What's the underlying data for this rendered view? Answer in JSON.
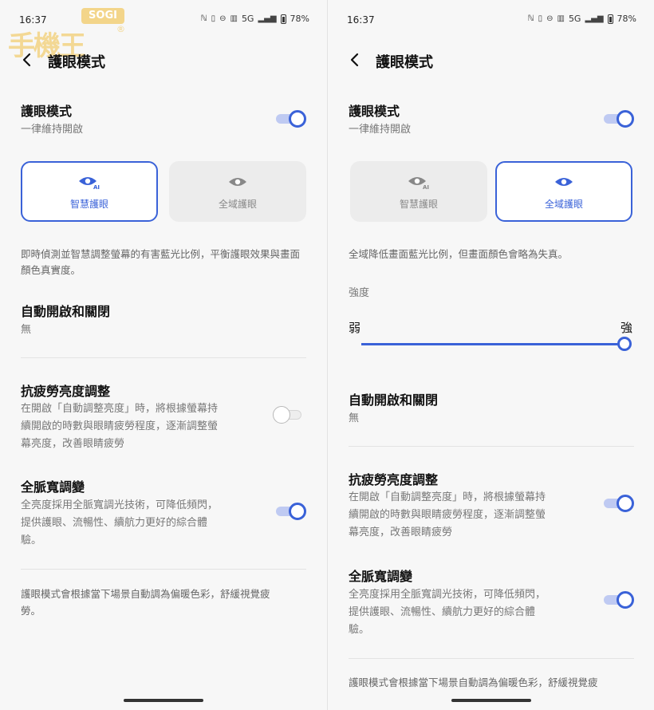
{
  "status": {
    "time": "16:37",
    "network": "5G",
    "battery": "78%"
  },
  "watermark": {
    "brand": "SOGI",
    "main": "手機王",
    "mark": "®"
  },
  "page": {
    "title": "護眼模式"
  },
  "eye_mode": {
    "title": "護眼模式",
    "subtitle": "一律維持開啟",
    "enabled": true
  },
  "modes": {
    "smart": "智慧護眼",
    "full": "全域護眼"
  },
  "left": {
    "selected_mode": "smart",
    "mode_desc": "即時偵測並智慧調整螢幕的有害藍光比例，平衡護眼效果與畫面顏色真實度。",
    "anti_fatigue_enabled": false,
    "dc_enabled": true
  },
  "right": {
    "selected_mode": "full",
    "mode_desc": "全域降低畫面藍光比例，但畫面顏色會略為失真。",
    "intensity": {
      "label": "強度",
      "min_label": "弱",
      "max_label": "強",
      "value": 1.0
    },
    "anti_fatigue_enabled": true,
    "dc_enabled": true
  },
  "auto_toggle": {
    "title": "自動開啟和關閉",
    "value": "無"
  },
  "anti_fatigue": {
    "title": "抗疲勞亮度調整",
    "desc_line1": "在開啟「自動調整亮度」時，將根據螢幕持",
    "desc_line2": "續開啟的時數與眼睛疲勞程度，逐漸調整螢",
    "desc_line3": "幕亮度，改善眼睛疲勞"
  },
  "dc_dimming": {
    "title": "全脈寬調變",
    "desc_line1": "全亮度採用全脈寬調光技術，可降低頻閃，",
    "desc_line2": "提供護眼、流暢性、續航力更好的綜合體",
    "desc_line3": "驗。"
  },
  "footer": {
    "note_line1": "護眼模式會根據當下場景自動調為偏暖色彩，舒緩視覺疲",
    "note_line2": "勞。"
  },
  "colors": {
    "accent": "#3a62d8",
    "track_on": "#bfcaf2",
    "card_bg": "#ececec"
  }
}
